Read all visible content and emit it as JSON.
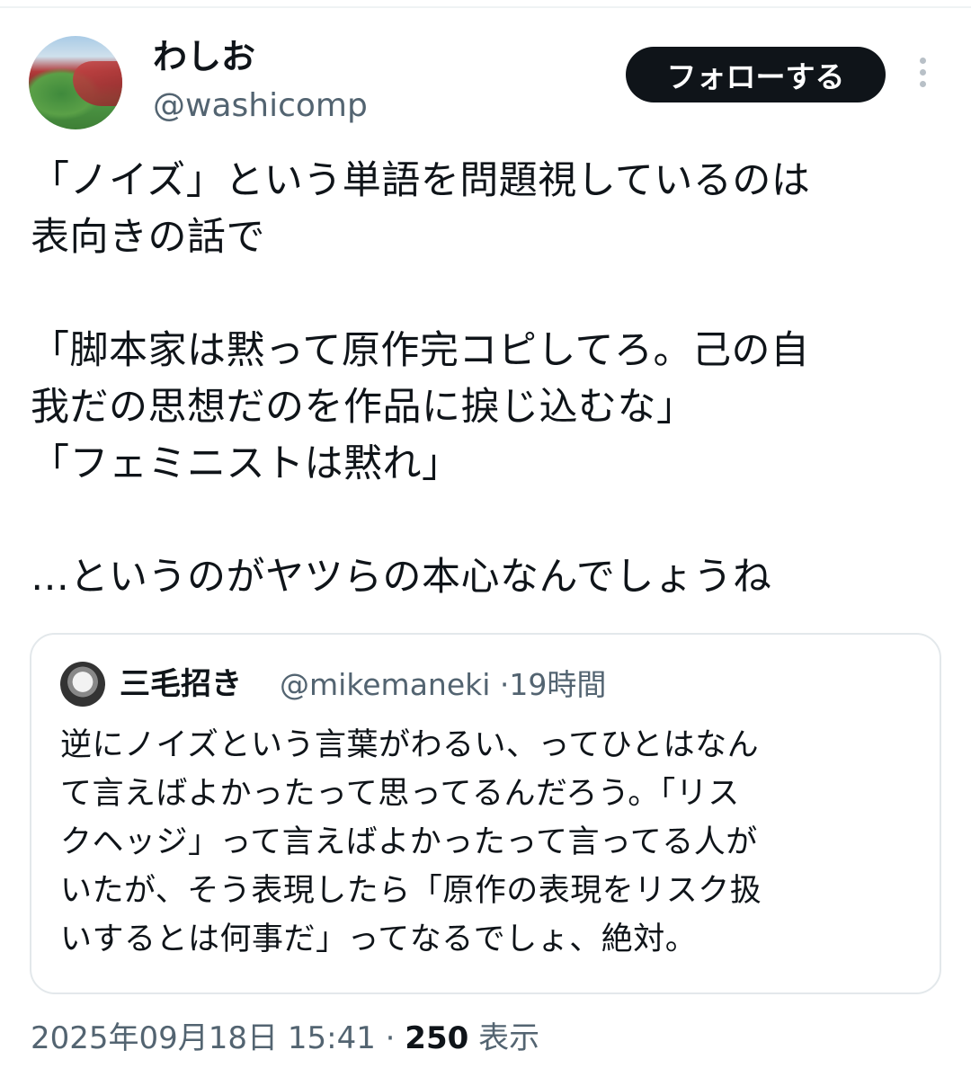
{
  "author": {
    "name": "わしお",
    "handle": "@washicomp",
    "follow_label": "フォローする"
  },
  "tweet": {
    "text": "「ノイズ」という単語を問題視しているのは\n表向きの話で\n\n「脚本家は黙って原作完コピしてろ。己の自\n我だの思想だのを作品に捩じ込むな」\n「フェミニストは黙れ」\n\n…というのがヤツらの本心なんでしょうね"
  },
  "quote": {
    "name": "三毛招き",
    "handle": "@mikemaneki",
    "separator": "·",
    "time": "19時間",
    "text": "逆にノイズという言葉がわるい、ってひとはなん\nて言えばよかったって思ってるんだろう。「リス\nクヘッジ」って言えばよかったって言ってる人が\nいたが、そう表現したら「原作の表現をリスク扱\nいするとは何事だ」ってなるでしょ、絶対。"
  },
  "footer": {
    "datetime": "2025年09月18日 15:41",
    "separator": "·",
    "views_count": "250",
    "views_label": "表示"
  },
  "icons": {
    "more": "more-vertical-icon",
    "avatar": "stadium-avatar",
    "quote_avatar": "anime-avatar"
  },
  "colors": {
    "text": "#0f1419",
    "secondary": "#536471",
    "button_bg": "#0f1419",
    "border": "#e3e8eb"
  }
}
